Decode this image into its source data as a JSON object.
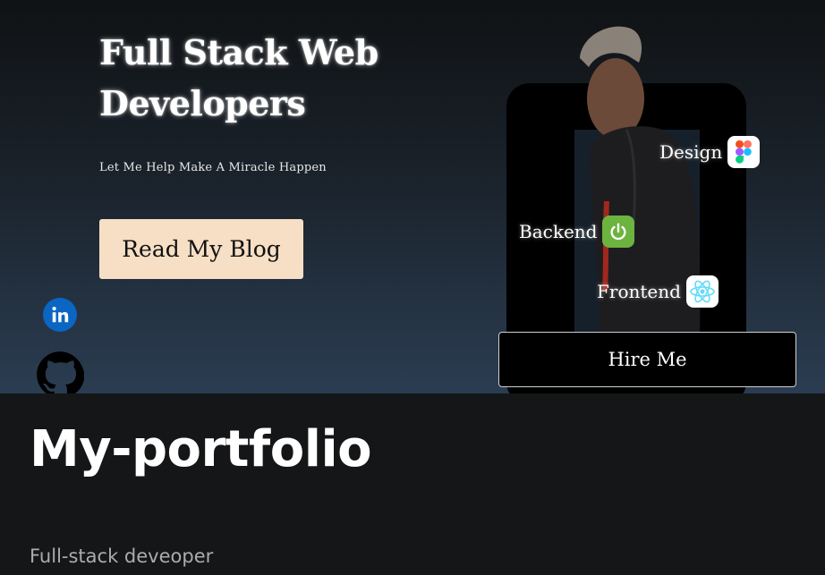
{
  "hero": {
    "title": "Full Stack Web Developers",
    "tagline": "Let Me Help Make A Miracle Happen",
    "cta_label": "Read My Blog",
    "hire_label": "Hire Me"
  },
  "social": {
    "linkedin_icon": "linkedin-icon",
    "github_icon": "github-icon"
  },
  "skills": [
    {
      "label": "Design",
      "icon": "figma-icon"
    },
    {
      "label": "Backend",
      "icon": "spring-power-icon"
    },
    {
      "label": "Frontend",
      "icon": "react-icon"
    }
  ],
  "repo": {
    "title": "My-portfolio",
    "description": "Full-stack deveoper"
  },
  "colors": {
    "cta_bg": "#f6dfc4",
    "linkedin": "#0a66c2",
    "spring_green": "#6db33f",
    "react_blue": "#61dafb"
  }
}
